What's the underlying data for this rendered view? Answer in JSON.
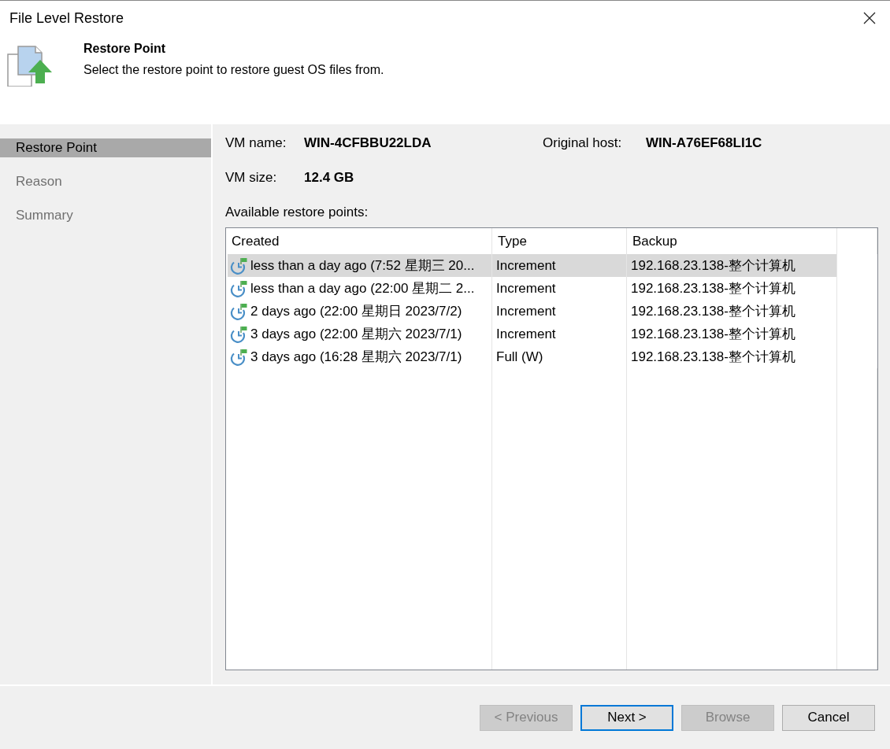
{
  "window": {
    "title": "File Level Restore"
  },
  "header": {
    "title": "Restore Point",
    "description": "Select the restore point to restore guest OS files from."
  },
  "sidebar": {
    "items": [
      {
        "label": "Restore Point",
        "selected": true
      },
      {
        "label": "Reason",
        "selected": false
      },
      {
        "label": "Summary",
        "selected": false
      }
    ]
  },
  "vm_info": [
    {
      "label": "VM name:",
      "value": "WIN-4CFBBU22LDA"
    },
    {
      "label": "Original host:",
      "value": "WIN-A76EF68LI1C"
    },
    {
      "label": "VM size:",
      "value": "12.4 GB"
    }
  ],
  "restore_points": {
    "label": "Available restore points:",
    "columns": [
      "Created",
      "Type",
      "Backup"
    ],
    "rows": [
      {
        "created": "less than a day ago (7:52 星期三 20...",
        "type": "Increment",
        "backup": "192.168.23.138-整个计算机",
        "selected": true
      },
      {
        "created": "less than a day ago (22:00 星期二 2...",
        "type": "Increment",
        "backup": "192.168.23.138-整个计算机",
        "selected": false
      },
      {
        "created": "2 days ago (22:00 星期日 2023/7/2)",
        "type": "Increment",
        "backup": "192.168.23.138-整个计算机",
        "selected": false
      },
      {
        "created": "3 days ago (22:00 星期六 2023/7/1)",
        "type": "Increment",
        "backup": "192.168.23.138-整个计算机",
        "selected": false
      },
      {
        "created": "3 days ago (16:28 星期六 2023/7/1)",
        "type": "Full (W)",
        "backup": "192.168.23.138-整个计算机",
        "selected": false
      }
    ]
  },
  "buttons": [
    {
      "label": "< Previous",
      "disabled": true,
      "focused": false
    },
    {
      "label": "Next >",
      "disabled": false,
      "focused": true
    },
    {
      "label": "Browse",
      "disabled": true,
      "focused": false
    },
    {
      "label": "Cancel",
      "disabled": false,
      "focused": false
    }
  ]
}
